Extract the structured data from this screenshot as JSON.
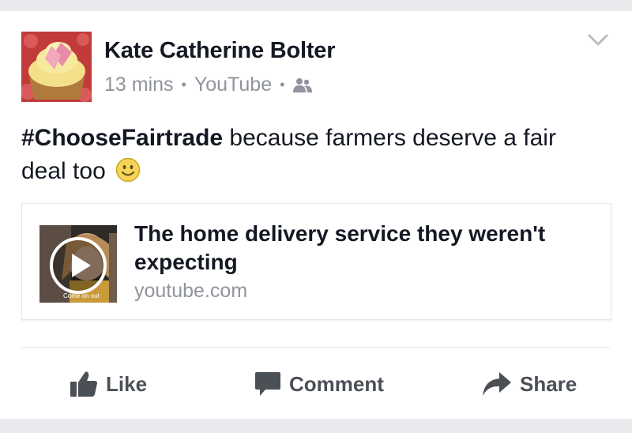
{
  "post": {
    "author": "Kate Catherine Bolter",
    "time": "13 mins",
    "source": "YouTube",
    "separator": "•",
    "audience_icon": "friends-icon",
    "options_icon": "chevron-down-icon",
    "message_hashtag": "#ChooseFairtrade",
    "message_text": " because farmers deserve a fair deal too",
    "message_emoji": "smiley-icon"
  },
  "link": {
    "title": "The home delivery service they weren't expecting",
    "domain": "youtube.com",
    "thumbnail_caption": "Come on out",
    "thumbnail_icon": "play-icon"
  },
  "actions": {
    "like_label": "Like",
    "comment_label": "Comment",
    "share_label": "Share"
  },
  "colors": {
    "text": "#141823",
    "secondary": "#90949c",
    "action": "#4b4f56",
    "background": "#e9eaed"
  }
}
